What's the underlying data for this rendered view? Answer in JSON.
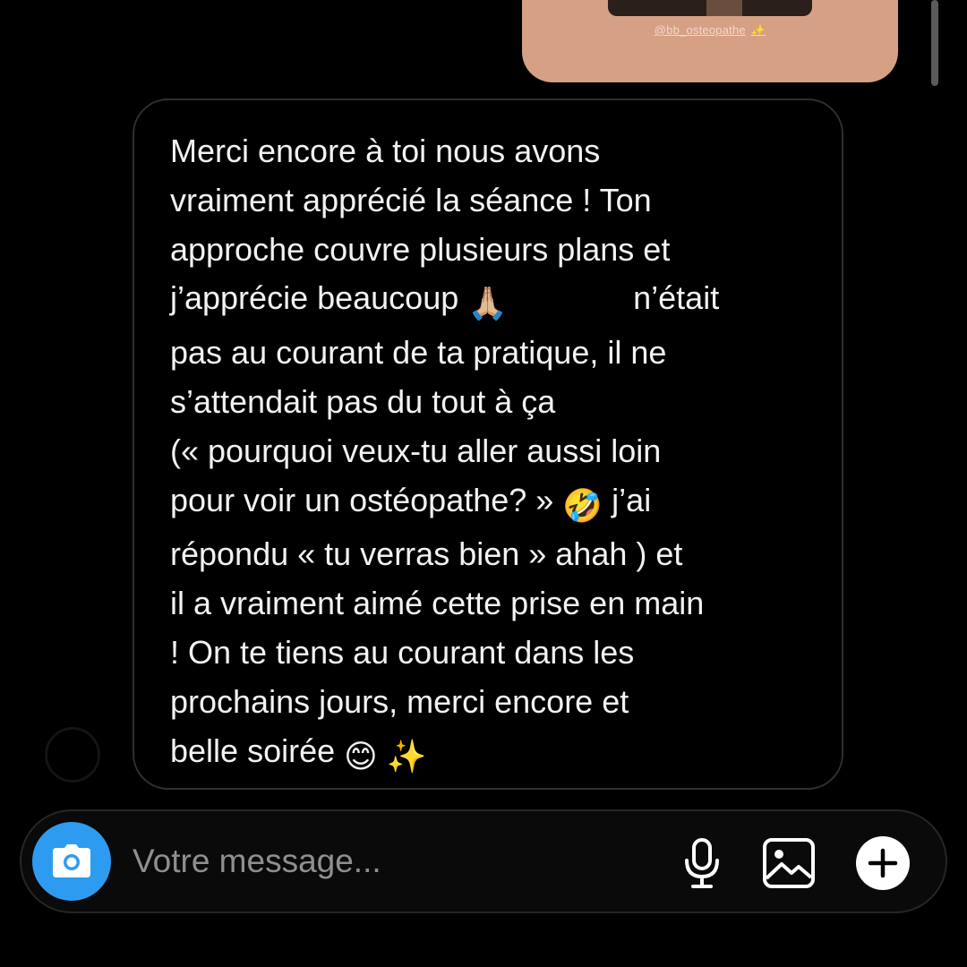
{
  "story": {
    "handle": "@bb_osteopathe",
    "sparkle": "✨",
    "thumb_caption": "bb_osteopathe"
  },
  "message": {
    "lines": [
      "Merci encore à toi nous avons",
      "vraiment apprécié la séance ! Ton",
      "approche couvre plusieurs plans et",
      "j’apprécie beaucoup",
      "pas au courant de ta pratique, il ne",
      "s’attendait pas du tout à ça",
      "(« pourquoi veux-tu aller aussi loin",
      "pour voir un ostéopathe? »",
      "répondu « tu verras bien » ahah ) et",
      "il a vraiment aimé cette prise en main",
      "! On te tiens au courant dans les",
      "prochains jours, merci encore et",
      "belle soirée"
    ],
    "line4_tail": "n’était",
    "line8_tail": "j’ai",
    "emoji_pray": "🙏🏼",
    "emoji_laugh": "🤣",
    "emoji_smile": "😊",
    "emoji_sparkles": "✨"
  },
  "composer": {
    "placeholder": "Votre message...",
    "value": ""
  },
  "colors": {
    "camera_button": "#2d9cf0",
    "story_card": "#d5a084",
    "bubble_border": "#2f2f2f",
    "text": "#f2f2f2",
    "placeholder": "#8f8f8f"
  },
  "icons": {
    "camera": "camera-icon",
    "mic": "microphone-icon",
    "gallery": "image-gallery-icon",
    "plus": "plus-circle-icon"
  }
}
